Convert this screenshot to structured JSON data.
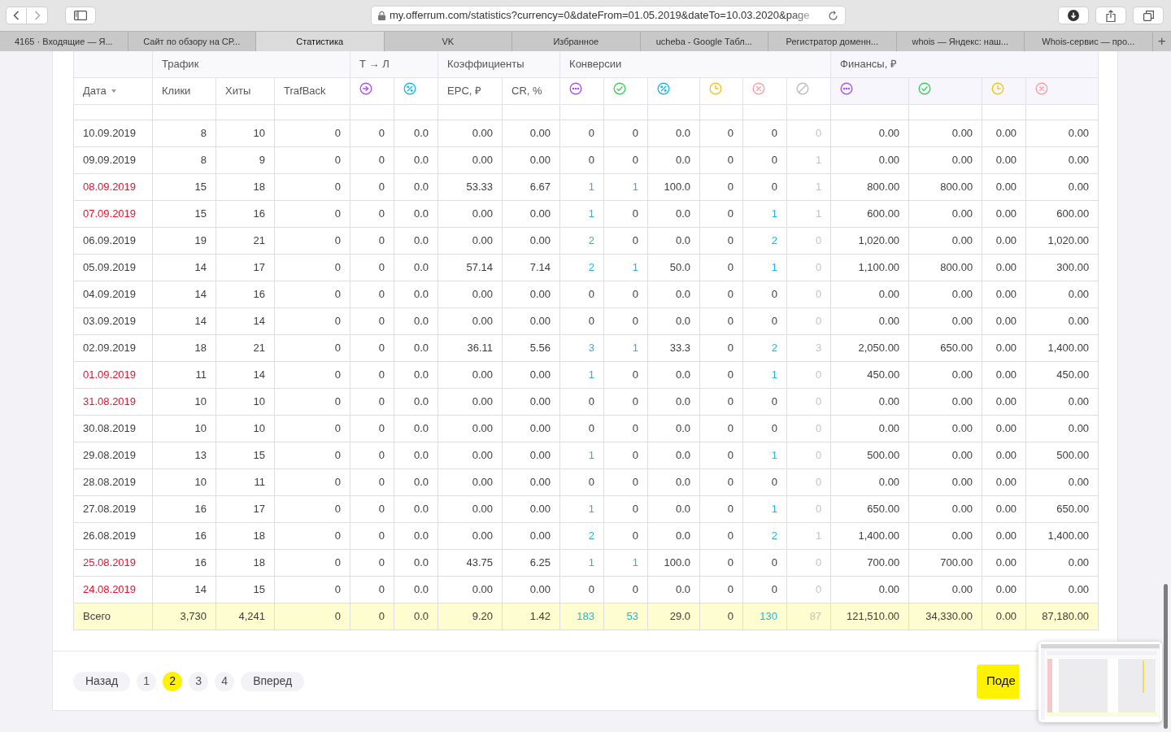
{
  "browser": {
    "url": "my.offerrum.com/statistics?currency=0&dateFrom=01.05.2019&dateTo=10.03.2020&page",
    "tabs": [
      {
        "label": "4165 · Входящие — Я...",
        "selected": false
      },
      {
        "label": "Сайт по обзору на СР...",
        "selected": false
      },
      {
        "label": "Статистика",
        "selected": true
      },
      {
        "label": "VK",
        "selected": false
      },
      {
        "label": "Избранное",
        "selected": false
      },
      {
        "label": "ucheba - Google Табл...",
        "selected": false
      },
      {
        "label": "Регистратор доменн...",
        "selected": false
      },
      {
        "label": "whois — Яндекс: наш...",
        "selected": false
      },
      {
        "label": "Whois-сервис — про...",
        "selected": false
      }
    ],
    "new_tab": "+"
  },
  "table": {
    "groups": [
      "Трафик",
      "Т → Л",
      "Коэффициенты",
      "Конверсии",
      "Финансы, ₽"
    ],
    "columns": [
      {
        "kind": "text",
        "label": "Дата"
      },
      {
        "kind": "text",
        "label": "Клики"
      },
      {
        "kind": "text",
        "label": "Хиты"
      },
      {
        "kind": "text",
        "label": "TrafBack"
      },
      {
        "kind": "icon",
        "color": "#a855f7"
      },
      {
        "kind": "icon",
        "color": "#22b8e6"
      },
      {
        "kind": "text",
        "label": "EPC, ₽"
      },
      {
        "kind": "text",
        "label": "CR, %"
      },
      {
        "kind": "icon",
        "color": "#a855f7"
      },
      {
        "kind": "icon",
        "color": "#3ecf5a"
      },
      {
        "kind": "icon",
        "color": "#22b8e6"
      },
      {
        "kind": "icon",
        "color": "#f5c518"
      },
      {
        "kind": "icon",
        "color": "#f7a1a6"
      },
      {
        "kind": "icon",
        "color": "#bdbdbd"
      },
      {
        "kind": "icon",
        "color": "#a855f7"
      },
      {
        "kind": "icon",
        "color": "#3ecf5a"
      },
      {
        "kind": "icon",
        "color": "#f5c518"
      },
      {
        "kind": "icon",
        "color": "#f7a1a6"
      }
    ],
    "rows": [
      {
        "weekend": false,
        "cells": [
          "10.09.2019",
          "8",
          "10",
          "0",
          "0",
          "0.0",
          "0.00",
          "0.00",
          "0",
          "0",
          "0.0",
          "0",
          "0",
          "0",
          "0.00",
          "0.00",
          "0.00",
          "0.00"
        ]
      },
      {
        "weekend": false,
        "cells": [
          "09.09.2019",
          "8",
          "9",
          "0",
          "0",
          "0.0",
          "0.00",
          "0.00",
          "0",
          "0",
          "0.0",
          "0",
          "0",
          "1",
          "0.00",
          "0.00",
          "0.00",
          "0.00"
        ]
      },
      {
        "weekend": true,
        "cells": [
          "08.09.2019",
          "15",
          "18",
          "0",
          "0",
          "0.0",
          "53.33",
          "6.67",
          {
            "text": "1",
            "link": true
          },
          {
            "text": "1",
            "link": true
          },
          "100.0",
          "0",
          "0",
          "1",
          "800.00",
          "800.00",
          "0.00",
          "0.00"
        ]
      },
      {
        "weekend": true,
        "cells": [
          "07.09.2019",
          "15",
          "16",
          "0",
          "0",
          "0.0",
          "0.00",
          "0.00",
          {
            "text": "1",
            "link": true
          },
          "0",
          "0.0",
          "0",
          {
            "text": "1",
            "link": true
          },
          "1",
          "600.00",
          "0.00",
          "0.00",
          "600.00"
        ]
      },
      {
        "weekend": false,
        "cells": [
          "06.09.2019",
          "19",
          "21",
          "0",
          "0",
          "0.0",
          "0.00",
          "0.00",
          {
            "text": "2",
            "link": true
          },
          "0",
          "0.0",
          "0",
          {
            "text": "2",
            "link": true
          },
          "0",
          "1,020.00",
          "0.00",
          "0.00",
          "1,020.00"
        ]
      },
      {
        "weekend": false,
        "cells": [
          "05.09.2019",
          "14",
          "17",
          "0",
          "0",
          "0.0",
          "57.14",
          "7.14",
          {
            "text": "2",
            "link": true
          },
          {
            "text": "1",
            "link": true
          },
          "50.0",
          "0",
          {
            "text": "1",
            "link": true
          },
          "0",
          "1,100.00",
          "800.00",
          "0.00",
          "300.00"
        ]
      },
      {
        "weekend": false,
        "cells": [
          "04.09.2019",
          "14",
          "16",
          "0",
          "0",
          "0.0",
          "0.00",
          "0.00",
          "0",
          "0",
          "0.0",
          "0",
          "0",
          "0",
          "0.00",
          "0.00",
          "0.00",
          "0.00"
        ]
      },
      {
        "weekend": false,
        "cells": [
          "03.09.2019",
          "14",
          "14",
          "0",
          "0",
          "0.0",
          "0.00",
          "0.00",
          "0",
          "0",
          "0.0",
          "0",
          "0",
          "0",
          "0.00",
          "0.00",
          "0.00",
          "0.00"
        ]
      },
      {
        "weekend": false,
        "cells": [
          "02.09.2019",
          "18",
          "21",
          "0",
          "0",
          "0.0",
          "36.11",
          "5.56",
          {
            "text": "3",
            "link": true
          },
          {
            "text": "1",
            "link": true
          },
          "33.3",
          "0",
          {
            "text": "2",
            "link": true
          },
          "3",
          "2,050.00",
          "650.00",
          "0.00",
          "1,400.00"
        ]
      },
      {
        "weekend": true,
        "cells": [
          "01.09.2019",
          "11",
          "14",
          "0",
          "0",
          "0.0",
          "0.00",
          "0.00",
          {
            "text": "1",
            "link": true
          },
          "0",
          "0.0",
          "0",
          {
            "text": "1",
            "link": true
          },
          "0",
          "450.00",
          "0.00",
          "0.00",
          "450.00"
        ]
      },
      {
        "weekend": true,
        "cells": [
          "31.08.2019",
          "10",
          "10",
          "0",
          "0",
          "0.0",
          "0.00",
          "0.00",
          "0",
          "0",
          "0.0",
          "0",
          "0",
          "0",
          "0.00",
          "0.00",
          "0.00",
          "0.00"
        ]
      },
      {
        "weekend": false,
        "cells": [
          "30.08.2019",
          "10",
          "10",
          "0",
          "0",
          "0.0",
          "0.00",
          "0.00",
          "0",
          "0",
          "0.0",
          "0",
          "0",
          "0",
          "0.00",
          "0.00",
          "0.00",
          "0.00"
        ]
      },
      {
        "weekend": false,
        "cells": [
          "29.08.2019",
          "13",
          "15",
          "0",
          "0",
          "0.0",
          "0.00",
          "0.00",
          {
            "text": "1",
            "link": true
          },
          "0",
          "0.0",
          "0",
          {
            "text": "1",
            "link": true
          },
          "0",
          "500.00",
          "0.00",
          "0.00",
          "500.00"
        ]
      },
      {
        "weekend": false,
        "cells": [
          "28.08.2019",
          "10",
          "11",
          "0",
          "0",
          "0.0",
          "0.00",
          "0.00",
          "0",
          "0",
          "0.0",
          "0",
          "0",
          "0",
          "0.00",
          "0.00",
          "0.00",
          "0.00"
        ]
      },
      {
        "weekend": false,
        "cells": [
          "27.08.2019",
          "16",
          "17",
          "0",
          "0",
          "0.0",
          "0.00",
          "0.00",
          {
            "text": "1",
            "link": true
          },
          "0",
          "0.0",
          "0",
          {
            "text": "1",
            "link": true
          },
          "0",
          "650.00",
          "0.00",
          "0.00",
          "650.00"
        ]
      },
      {
        "weekend": false,
        "cells": [
          "26.08.2019",
          "16",
          "18",
          "0",
          "0",
          "0.0",
          "0.00",
          "0.00",
          {
            "text": "2",
            "link": true
          },
          "0",
          "0.0",
          "0",
          {
            "text": "2",
            "link": true
          },
          "1",
          "1,400.00",
          "0.00",
          "0.00",
          "1,400.00"
        ]
      },
      {
        "weekend": true,
        "cells": [
          "25.08.2019",
          "16",
          "18",
          "0",
          "0",
          "0.0",
          "43.75",
          "6.25",
          {
            "text": "1",
            "link": true
          },
          {
            "text": "1",
            "link": true
          },
          "100.0",
          "0",
          "0",
          "0",
          "700.00",
          "700.00",
          "0.00",
          "0.00"
        ]
      },
      {
        "weekend": true,
        "cells": [
          "24.08.2019",
          "14",
          "15",
          "0",
          "0",
          "0.0",
          "0.00",
          "0.00",
          "0",
          "0",
          "0.0",
          "0",
          "0",
          "0",
          "0.00",
          "0.00",
          "0.00",
          "0.00"
        ]
      }
    ],
    "total": {
      "cells": [
        "Всего",
        "3,730",
        "4,241",
        "0",
        "0",
        "0.0",
        "9.20",
        "1.42",
        {
          "text": "183",
          "link": true
        },
        {
          "text": "53",
          "link": true
        },
        "29.0",
        "0",
        {
          "text": "130",
          "link": true
        },
        "87",
        "121,510.00",
        "34,330.00",
        "0.00",
        "87,180.00"
      ]
    }
  },
  "pagination": {
    "prev": "Назад",
    "next": "Вперед",
    "pages": [
      {
        "label": "1",
        "selected": false
      },
      {
        "label": "2",
        "selected": true
      },
      {
        "label": "3",
        "selected": false
      },
      {
        "label": "4",
        "selected": false
      }
    ]
  },
  "submit_button": "Поде"
}
